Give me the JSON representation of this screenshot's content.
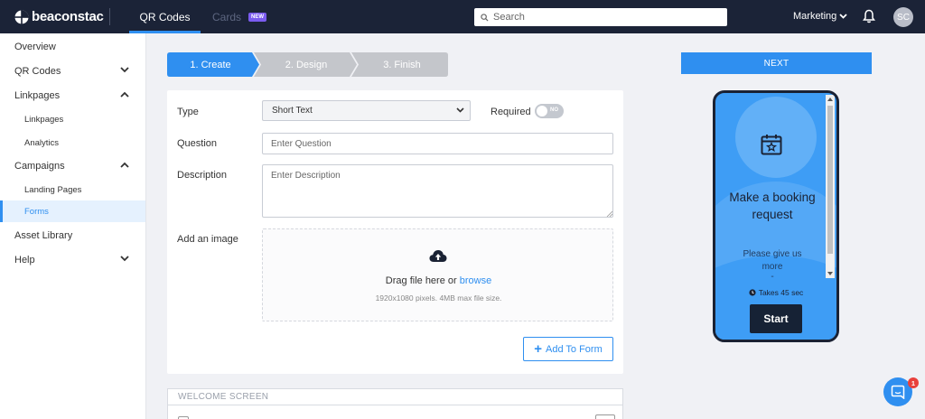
{
  "brand": {
    "name": "beaconstac"
  },
  "topnav": {
    "tabs": [
      {
        "label": "QR Codes"
      },
      {
        "label": "Cards",
        "badge": "NEW"
      }
    ],
    "search_placeholder": "Search",
    "workspace": "Marketing",
    "avatar_initials": "SC"
  },
  "sidebar": {
    "items": [
      {
        "label": "Overview"
      },
      {
        "label": "QR Codes"
      },
      {
        "label": "Linkpages"
      },
      {
        "label": "Linkpages"
      },
      {
        "label": "Analytics"
      },
      {
        "label": "Campaigns"
      },
      {
        "label": "Landing Pages"
      },
      {
        "label": "Forms"
      },
      {
        "label": "Asset Library"
      },
      {
        "label": "Help"
      }
    ]
  },
  "stepper": {
    "steps": [
      {
        "label": "1. Create"
      },
      {
        "label": "2. Design"
      },
      {
        "label": "3. Finish"
      }
    ],
    "colors": {
      "active": "#2f8ff0",
      "inactive": "#c4c6cb"
    }
  },
  "form": {
    "type_label": "Type",
    "type_value": "Short Text",
    "required_label": "Required",
    "required_toggle": "NO",
    "question_label": "Question",
    "question_placeholder": "Enter Question",
    "description_label": "Description",
    "description_placeholder": "Enter Description",
    "image_label": "Add an image",
    "drop_text": "Drag file here or",
    "drop_link": "browse",
    "drop_hint": "1920x1080 pixels. 4MB max file size.",
    "add_button": "Add To Form",
    "welcome_section": "WELCOME SCREEN"
  },
  "preview": {
    "next_button": "NEXT",
    "title": "Make a booking request",
    "description": "Please give us more",
    "dots": "-",
    "time": "Takes 45 sec",
    "start_button": "Start"
  },
  "chat": {
    "badge": "1"
  }
}
